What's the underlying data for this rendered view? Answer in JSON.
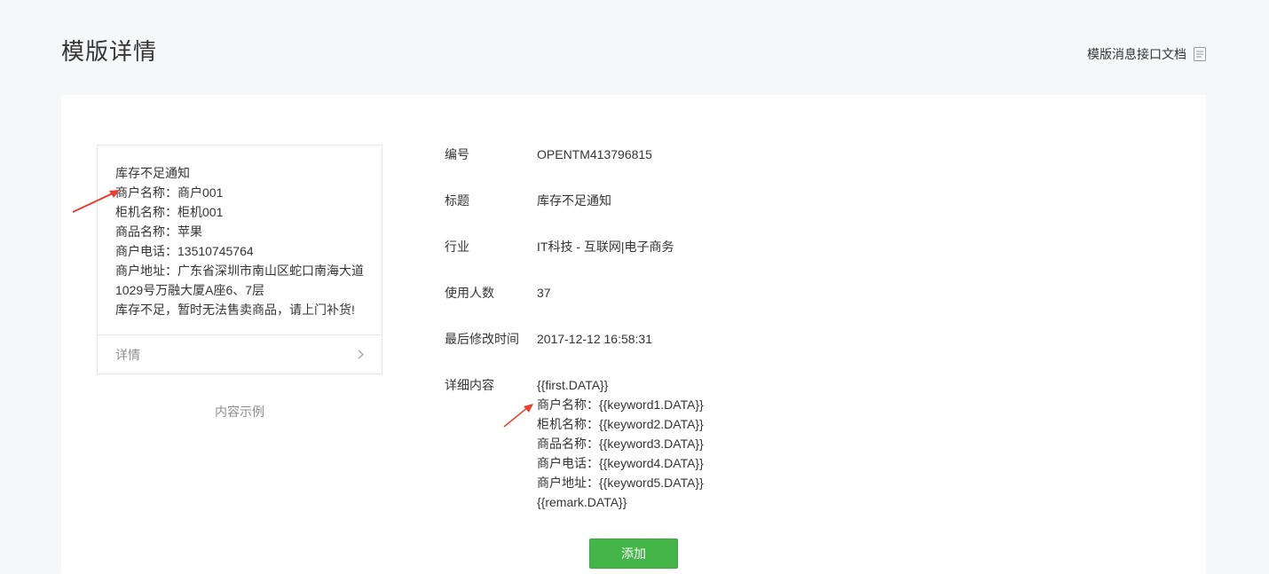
{
  "header": {
    "title": "模版详情",
    "doc_link": "模版消息接口文档"
  },
  "preview": {
    "lines": [
      "库存不足通知",
      "商户名称：商户001",
      "柜机名称：柜机001",
      "商品名称：苹果",
      "商户电话：13510745764",
      "商户地址：广东省深圳市南山区蛇口南海大道1029号万融大厦A座6、7层",
      "库存不足，暂时无法售卖商品，请上门补货!"
    ],
    "footer_label": "详情",
    "caption": "内容示例"
  },
  "info": {
    "rows": [
      {
        "label": "编号",
        "value": "OPENTM413796815"
      },
      {
        "label": "标题",
        "value": "库存不足通知"
      },
      {
        "label": "行业",
        "value": "IT科技 - 互联网|电子商务"
      },
      {
        "label": "使用人数",
        "value": "37"
      },
      {
        "label": "最后修改时间",
        "value": "2017-12-12 16:58:31"
      }
    ],
    "content_label": "详细内容",
    "content_lines": [
      "{{first.DATA}}",
      "商户名称：{{keyword1.DATA}}",
      "柜机名称：{{keyword2.DATA}}",
      "商品名称：{{keyword3.DATA}}",
      "商户电话：{{keyword4.DATA}}",
      "商户地址：{{keyword5.DATA}}",
      "{{remark.DATA}}"
    ]
  },
  "actions": {
    "add_label": "添加"
  },
  "colors": {
    "accent_green": "#44b549",
    "annotation_red": "#e8402f"
  },
  "icons": {
    "doc": "document-icon",
    "chevron": "chevron-right-icon"
  }
}
